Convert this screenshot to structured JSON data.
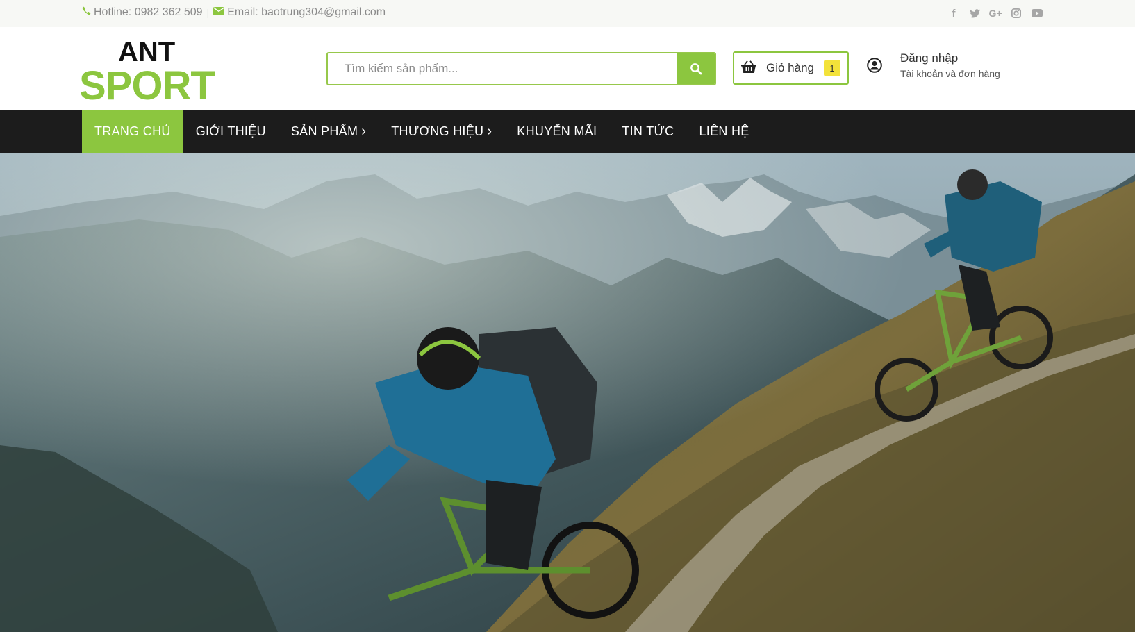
{
  "topbar": {
    "hotline": "Hotline: 0982 362 509",
    "separator": "|",
    "email": "Email: baotrung304@gmail.com",
    "social": [
      "facebook-icon",
      "twitter-icon",
      "google-plus-icon",
      "instagram-icon",
      "youtube-icon"
    ]
  },
  "header": {
    "logo": {
      "top": "ANT",
      "bottom": "SPORT"
    },
    "search": {
      "placeholder": "Tìm kiếm sản phẩm...",
      "value": ""
    },
    "cart": {
      "label": "Giỏ hàng",
      "count": "1"
    },
    "account": {
      "title": "Đăng nhập",
      "subtitle": "Tài khoản và đơn hàng"
    }
  },
  "nav": {
    "items": [
      {
        "label": "TRANG CHỦ",
        "active": true,
        "has_submenu": false
      },
      {
        "label": "GIỚI THIỆU",
        "active": false,
        "has_submenu": false
      },
      {
        "label": "SẢN PHẨM",
        "active": false,
        "has_submenu": true
      },
      {
        "label": "THƯƠNG HIỆU",
        "active": false,
        "has_submenu": true
      },
      {
        "label": "KHUYẾN MÃI",
        "active": false,
        "has_submenu": false
      },
      {
        "label": "TIN TỨC",
        "active": false,
        "has_submenu": false
      },
      {
        "label": "LIÊN HỆ",
        "active": false,
        "has_submenu": false
      }
    ]
  },
  "colors": {
    "brand_green": "#8cc63f",
    "nav_bg": "#1c1c1c",
    "badge_yellow": "#f3e23a"
  }
}
